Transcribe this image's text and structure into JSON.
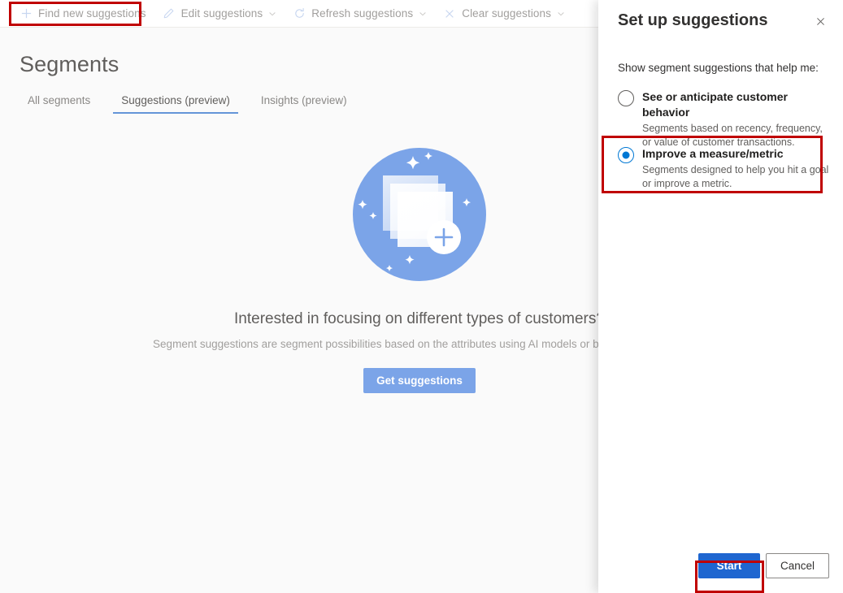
{
  "toolbar": {
    "items": [
      {
        "label": "Find new suggestions",
        "icon": "plus-icon",
        "has_chevron": false,
        "disabled": true
      },
      {
        "label": "Edit suggestions",
        "icon": "pencil-icon",
        "has_chevron": true,
        "disabled": true
      },
      {
        "label": "Refresh suggestions",
        "icon": "refresh-icon",
        "has_chevron": true,
        "disabled": true
      },
      {
        "label": "Clear suggestions",
        "icon": "close-icon",
        "has_chevron": true,
        "disabled": true
      }
    ]
  },
  "page": {
    "title": "Segments",
    "tabs": [
      {
        "label": "All segments",
        "active": false
      },
      {
        "label": "Suggestions (preview)",
        "active": true
      },
      {
        "label": "Insights (preview)",
        "active": false
      }
    ],
    "empty_state": {
      "headline": "Interested in focusing on different types of customers?",
      "subtitle": "Segment suggestions are segment possibilities based on the attributes using AI models or based on activities.",
      "button_label": "Get suggestions",
      "illustration": "stacked-cards-add-illustration"
    }
  },
  "panel": {
    "title": "Set up suggestions",
    "close_icon": "close-icon",
    "prompt": "Show segment suggestions that help me:",
    "options": [
      {
        "title": "See or anticipate customer behavior",
        "description": "Segments based on recency, frequency, or value of customer transactions.",
        "selected": false
      },
      {
        "title": "Improve a measure/metric",
        "description": "Segments designed to help you hit a goal or improve a metric.",
        "selected": true
      }
    ],
    "footer": {
      "primary_label": "Start",
      "secondary_label": "Cancel"
    }
  },
  "colors": {
    "accent_blue": "#0078d4",
    "primary_button": "#1f66d0",
    "illustration_blue": "#7ba4e8",
    "annotation_red": "#c00000",
    "tab_underline": "#6495d8",
    "page_background": "#fafafa"
  },
  "annotations": [
    {
      "target": "find-new-suggestions-toolbar-item"
    },
    {
      "target": "improve-metric-radio-option"
    },
    {
      "target": "start-button"
    }
  ]
}
